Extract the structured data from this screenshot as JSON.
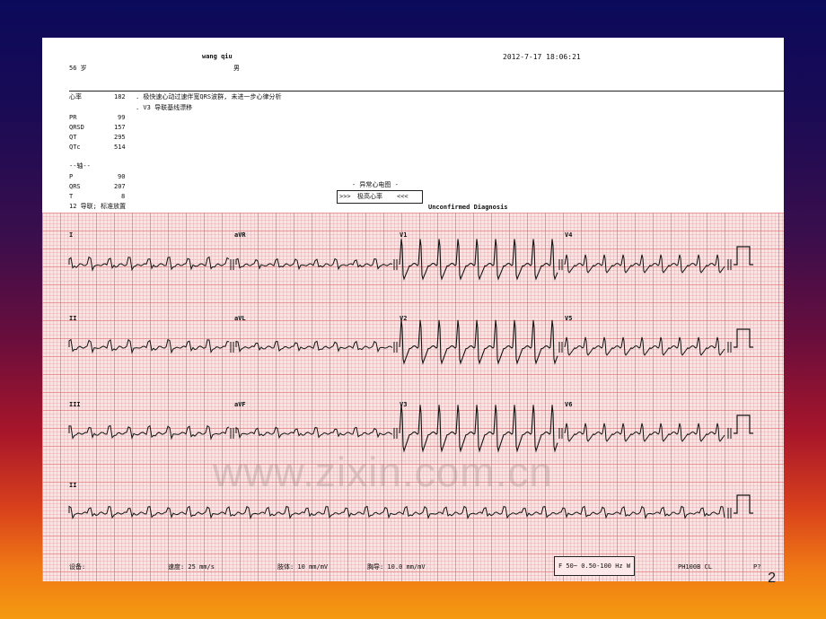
{
  "patient": {
    "name": "wang qiu",
    "age": "56 岁",
    "sex": "男",
    "datetime": "2012-7-17  18:06:21"
  },
  "interpretation": {
    "hr_label": "心率",
    "hr_value": "182",
    "line1": ". 极快速心动过速伴宽QRS波群, 未进一步心律分析",
    "line2": ". V3 导联基线漂移"
  },
  "intervals": {
    "pr_label": "PR",
    "pr": "99",
    "qrsd_label": "QRSD",
    "qrsd": "157",
    "qt_label": "QT",
    "qt": "295",
    "qtc_label": "QTc",
    "qtc": "514"
  },
  "axis": {
    "title": "--轴--",
    "p_label": "P",
    "p": "90",
    "qrs_label": "QRS",
    "qrs": "207",
    "t_label": "T",
    "t": "8"
  },
  "classification": "- 异常心电图 -",
  "banner_left": ">>>",
  "banner_text": "极高心率",
  "banner_right": "<<<",
  "lead_placement": "12 导联; 标准放置",
  "unconfirmed": "Unconfirmed Diagnosis",
  "leads": [
    "I",
    "aVR",
    "V1",
    "V4",
    "II",
    "aVL",
    "V2",
    "V5",
    "III",
    "aVF",
    "V3",
    "V6",
    "II"
  ],
  "footer": {
    "device_label": "设备:",
    "speed": "速度: 25 mm/s",
    "limb": "肢体: 10 mm/mV",
    "chest": "胸导: 10.0 mm/mV",
    "filter": "F 50~ 0.50-100 Hz W",
    "model": "PH100B  CL",
    "page": "P?"
  },
  "watermark": "www.zixin.com.cn",
  "slide_number": "2",
  "colors": {
    "grid_major": "#e86e6e",
    "grid_minor": "#f0a5a5",
    "paper": "#fbe3e3",
    "trace": "#111111"
  }
}
